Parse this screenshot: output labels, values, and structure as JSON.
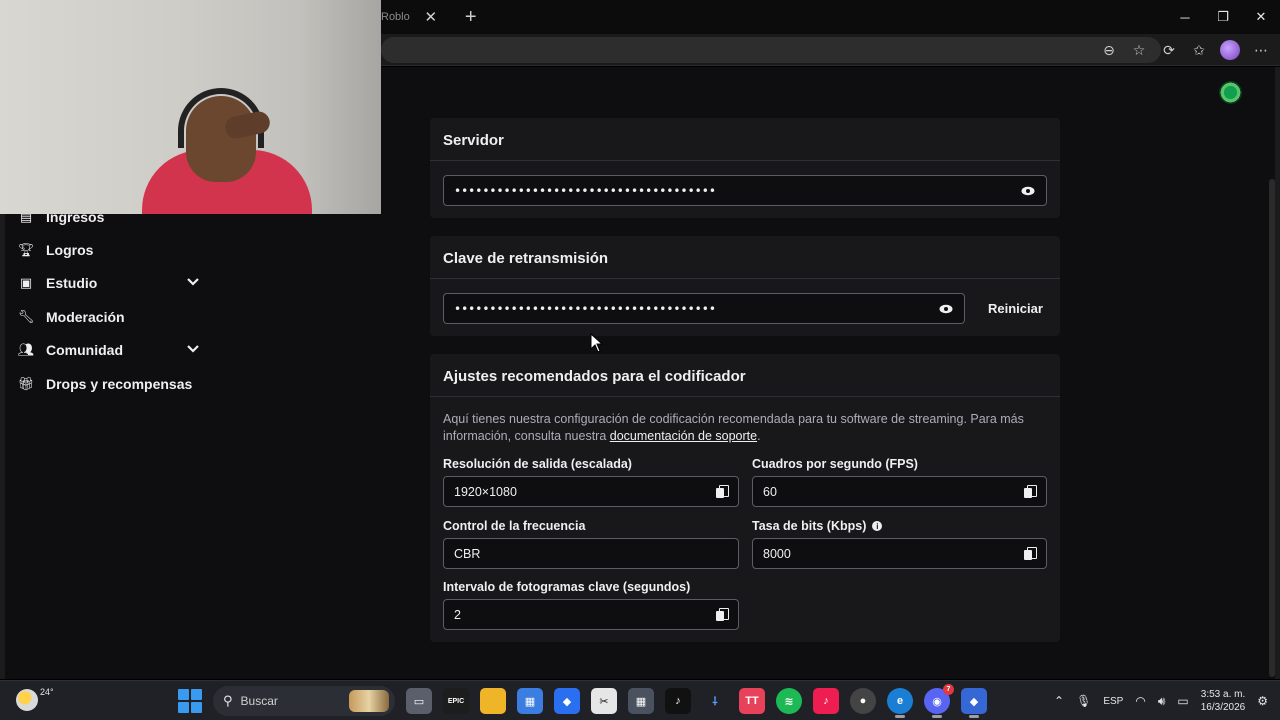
{
  "browser": {
    "tab_title_fragment": "Roblo",
    "window_controls": {
      "minimize": "─",
      "maximize": "❐",
      "close": "✕"
    }
  },
  "sidebar": {
    "items": [
      {
        "label": "Ingresos",
        "icon": "coins-icon",
        "has_chevron": false
      },
      {
        "label": "Logros",
        "icon": "trophy-icon",
        "has_chevron": false
      },
      {
        "label": "Estudio",
        "icon": "film-icon",
        "has_chevron": true
      },
      {
        "label": "Moderación",
        "icon": "wrench-icon",
        "has_chevron": false
      },
      {
        "label": "Comunidad",
        "icon": "people-icon",
        "has_chevron": true
      },
      {
        "label": "Drops y recompensas",
        "icon": "gift-icon",
        "has_chevron": false
      }
    ]
  },
  "server_card": {
    "title": "Servidor",
    "masked_value": "•••••••••••••••••••••••••••••••••••••"
  },
  "stream_key_card": {
    "title": "Clave de retransmisión",
    "masked_value": "•••••••••••••••••••••••••••••••••••••",
    "reset_label": "Reiniciar"
  },
  "encoder_card": {
    "title": "Ajustes recomendados para el codificador",
    "description_pre": "Aquí tienes nuestra configuración de codificación recomendada para tu software de streaming. Para más información, consulta nuestra ",
    "description_link": "documentación de soporte",
    "description_post": ".",
    "fields": {
      "resolution": {
        "label": "Resolución de salida (escalada)",
        "value": "1920×1080"
      },
      "fps": {
        "label": "Cuadros por segundo (FPS)",
        "value": "60"
      },
      "rate_control": {
        "label": "Control de la frecuencia",
        "value": "CBR"
      },
      "bitrate": {
        "label": "Tasa de bits (Kbps)",
        "value": "8000"
      },
      "keyframe": {
        "label": "Intervalo de fotogramas clave (segundos)",
        "value": "2"
      }
    }
  },
  "taskbar": {
    "weather_temp": "24°",
    "search_placeholder": "Buscar",
    "language": "ESP",
    "time": "3:53 a. m.",
    "date": "16/3/2026",
    "discord_badge": "7"
  },
  "colors": {
    "accent_start": "#3a9af0",
    "card_bg": "#18181b",
    "page_bg": "#0e0e10"
  }
}
